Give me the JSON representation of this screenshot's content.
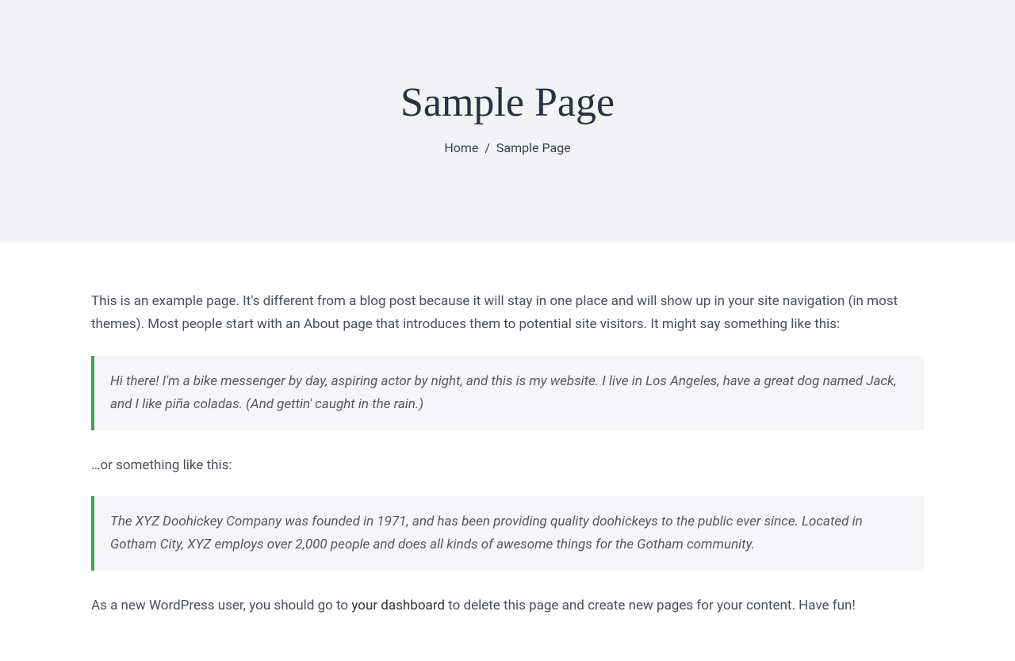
{
  "header": {
    "title": "Sample Page",
    "breadcrumb": {
      "home": "Home",
      "separator": "/",
      "current": "Sample Page"
    }
  },
  "content": {
    "intro": "This is an example page. It's different from a blog post because it will stay in one place and will show up in your site navigation (in most themes). Most people start with an About page that introduces them to potential site visitors. It might say something like this:",
    "quote1": "Hi there! I'm a bike messenger by day, aspiring actor by night, and this is my website. I live in Los Angeles, have a great dog named Jack, and I like piña coladas. (And gettin' caught in the rain.)",
    "middle": "…or something like this:",
    "quote2": "The XYZ Doohickey Company was founded in 1971, and has been providing quality doohickeys to the public ever since. Located in Gotham City, XYZ employs over 2,000 people and does all kinds of awesome things for the Gotham community.",
    "outro_before": "As a new WordPress user, you should go to ",
    "outro_link": "your dashboard",
    "outro_after": " to delete this page and create new pages for your content. Have fun!"
  }
}
